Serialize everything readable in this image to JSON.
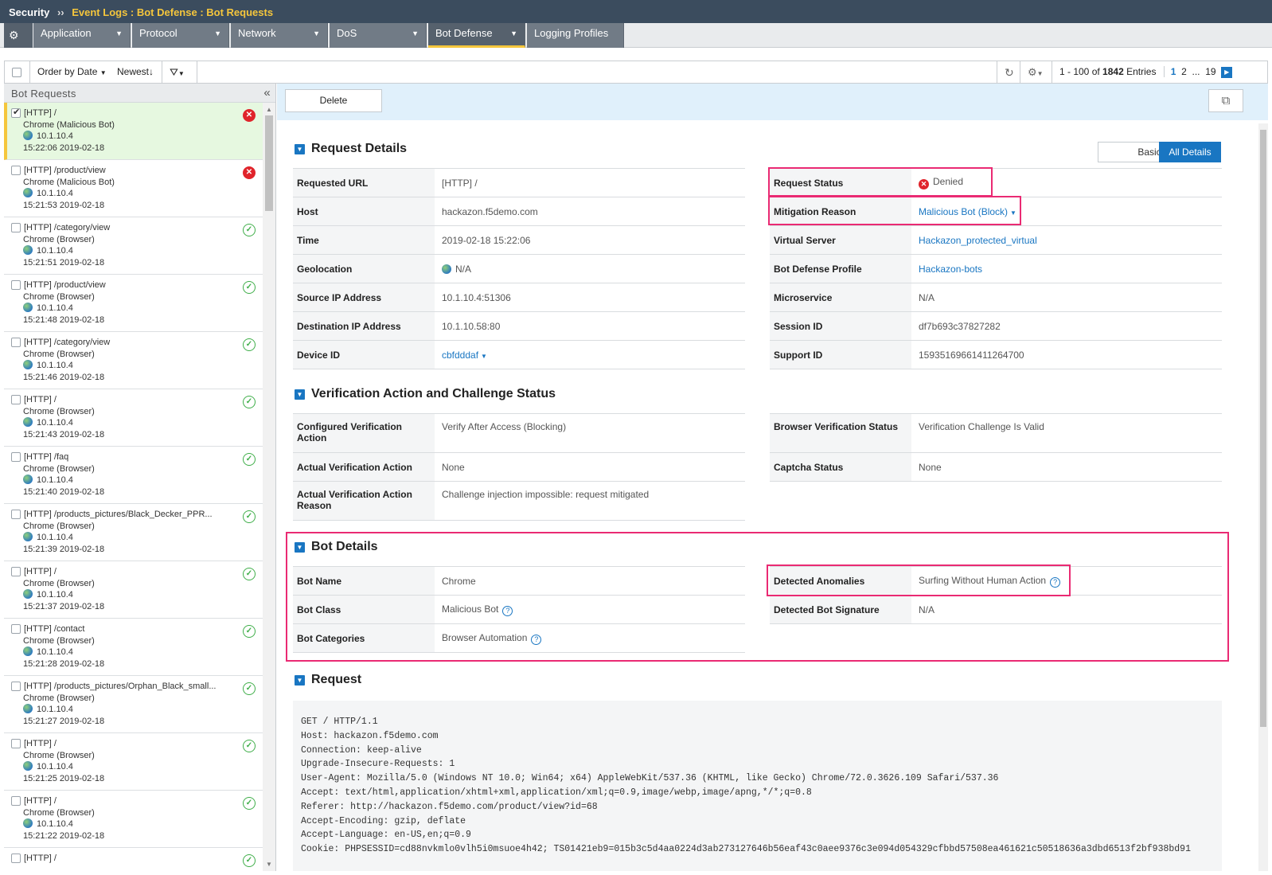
{
  "titlebar": {
    "section": "Security",
    "sep": "››",
    "crumb": "Event Logs : Bot Defense : Bot Requests"
  },
  "nav": {
    "gear": "⚙",
    "tabs": [
      "Application",
      "Protocol",
      "Network",
      "DoS",
      "Bot Defense",
      "Logging Profiles"
    ],
    "active_tab": "Bot Defense"
  },
  "toolbar": {
    "order_by": "Order by Date",
    "newest": "Newest",
    "entries_prefix": "1 - 100 of",
    "entries_total": "1842",
    "entries_suffix": "Entries",
    "pages": [
      "1",
      "2",
      "...",
      "19"
    ]
  },
  "sidebar": {
    "title": "Bot Requests",
    "items": [
      {
        "path": "[HTTP] /",
        "client": "Chrome (Malicious Bot)",
        "ip": "10.1.10.4",
        "time": "15:22:06 2019-02-18",
        "status": "denied",
        "checked": true
      },
      {
        "path": "[HTTP] /product/view",
        "client": "Chrome (Malicious Bot)",
        "ip": "10.1.10.4",
        "time": "15:21:53 2019-02-18",
        "status": "denied",
        "checked": false
      },
      {
        "path": "[HTTP] /category/view",
        "client": "Chrome (Browser)",
        "ip": "10.1.10.4",
        "time": "15:21:51 2019-02-18",
        "status": "ok",
        "checked": false
      },
      {
        "path": "[HTTP] /product/view",
        "client": "Chrome (Browser)",
        "ip": "10.1.10.4",
        "time": "15:21:48 2019-02-18",
        "status": "ok",
        "checked": false
      },
      {
        "path": "[HTTP] /category/view",
        "client": "Chrome (Browser)",
        "ip": "10.1.10.4",
        "time": "15:21:46 2019-02-18",
        "status": "ok",
        "checked": false
      },
      {
        "path": "[HTTP] /",
        "client": "Chrome (Browser)",
        "ip": "10.1.10.4",
        "time": "15:21:43 2019-02-18",
        "status": "ok",
        "checked": false
      },
      {
        "path": "[HTTP] /faq",
        "client": "Chrome (Browser)",
        "ip": "10.1.10.4",
        "time": "15:21:40 2019-02-18",
        "status": "ok",
        "checked": false
      },
      {
        "path": "[HTTP] /products_pictures/Black_Decker_PPR...",
        "client": "Chrome (Browser)",
        "ip": "10.1.10.4",
        "time": "15:21:39 2019-02-18",
        "status": "ok",
        "checked": false
      },
      {
        "path": "[HTTP] /",
        "client": "Chrome (Browser)",
        "ip": "10.1.10.4",
        "time": "15:21:37 2019-02-18",
        "status": "ok",
        "checked": false
      },
      {
        "path": "[HTTP] /contact",
        "client": "Chrome (Browser)",
        "ip": "10.1.10.4",
        "time": "15:21:28 2019-02-18",
        "status": "ok",
        "checked": false
      },
      {
        "path": "[HTTP] /products_pictures/Orphan_Black_small...",
        "client": "Chrome (Browser)",
        "ip": "10.1.10.4",
        "time": "15:21:27 2019-02-18",
        "status": "ok",
        "checked": false
      },
      {
        "path": "[HTTP] /",
        "client": "Chrome (Browser)",
        "ip": "10.1.10.4",
        "time": "15:21:25 2019-02-18",
        "status": "ok",
        "checked": false
      },
      {
        "path": "[HTTP] /",
        "client": "Chrome (Browser)",
        "ip": "10.1.10.4",
        "time": "15:21:22 2019-02-18",
        "status": "ok",
        "checked": false
      },
      {
        "path": "[HTTP] /",
        "client": "",
        "ip": "",
        "time": "",
        "status": "ok",
        "checked": false
      }
    ]
  },
  "main": {
    "delete_label": "Delete",
    "view_basic": "Basic",
    "view_all": "All Details",
    "request_details": {
      "title": "Request Details",
      "left": [
        {
          "label": "Requested URL",
          "value": "[HTTP] /"
        },
        {
          "label": "Host",
          "value": "hackazon.f5demo.com"
        },
        {
          "label": "Time",
          "value": "2019-02-18 15:22:06"
        },
        {
          "label": "Geolocation",
          "value": "N/A"
        },
        {
          "label": "Source IP Address",
          "value": "10.1.10.4:51306"
        },
        {
          "label": "Destination IP Address",
          "value": "10.1.10.58:80"
        },
        {
          "label": "Device ID",
          "value": "cbfdddaf"
        }
      ],
      "right": [
        {
          "label": "Request Status",
          "value": "Denied"
        },
        {
          "label": "Mitigation Reason",
          "value": "Malicious Bot (Block)"
        },
        {
          "label": "Virtual Server",
          "value": "Hackazon_protected_virtual"
        },
        {
          "label": "Bot Defense Profile",
          "value": "Hackazon-bots"
        },
        {
          "label": "Microservice",
          "value": "N/A"
        },
        {
          "label": "Session ID",
          "value": "df7b693c37827282"
        },
        {
          "label": "Support ID",
          "value": "15935169661411264700"
        }
      ]
    },
    "verification": {
      "title": "Verification Action and Challenge Status",
      "left": [
        {
          "label": "Configured Verification Action",
          "value": "Verify After Access (Blocking)"
        },
        {
          "label": "Actual Verification Action",
          "value": "None"
        },
        {
          "label": "Actual Verification Action Reason",
          "value": "Challenge injection impossible: request mitigated"
        }
      ],
      "right": [
        {
          "label": "Browser Verification Status",
          "value": "Verification Challenge Is Valid"
        },
        {
          "label": "Captcha Status",
          "value": "None"
        }
      ]
    },
    "bot_details": {
      "title": "Bot Details",
      "left": [
        {
          "label": "Bot Name",
          "value": "Chrome"
        },
        {
          "label": "Bot Class",
          "value": "Malicious Bot"
        },
        {
          "label": "Bot Categories",
          "value": "Browser Automation"
        }
      ],
      "right": [
        {
          "label": "Detected Anomalies",
          "value": "Surfing Without Human Action"
        },
        {
          "label": "Detected Bot Signature",
          "value": "N/A"
        }
      ]
    },
    "request": {
      "title": "Request",
      "lines": [
        "GET / HTTP/1.1",
        "Host: hackazon.f5demo.com",
        "Connection: keep-alive",
        "Upgrade-Insecure-Requests: 1",
        "User-Agent: Mozilla/5.0 (Windows NT 10.0; Win64; x64) AppleWebKit/537.36 (KHTML, like Gecko) Chrome/72.0.3626.109 Safari/537.36",
        "Accept: text/html,application/xhtml+xml,application/xml;q=0.9,image/webp,image/apng,*/*;q=0.8",
        "Referer: http://hackazon.f5demo.com/product/view?id=68",
        "Accept-Encoding: gzip, deflate",
        "Accept-Language: en-US,en;q=0.9",
        "Cookie: PHPSESSID=cd88nvkmlo0vlh5i0msuoe4h42; TS01421eb9=015b3c5d4aa0224d3ab273127646b56eaf43c0aee9376c3e094d054329cfbbd57508ea461621c50518636a3dbd6513f2bf938bd91"
      ]
    }
  },
  "colors": {
    "accent": "#1976c2",
    "highlight": "#ea2a73",
    "denied": "#e0242b",
    "ok": "#3fae49",
    "nav_active": "#f5c63c"
  }
}
